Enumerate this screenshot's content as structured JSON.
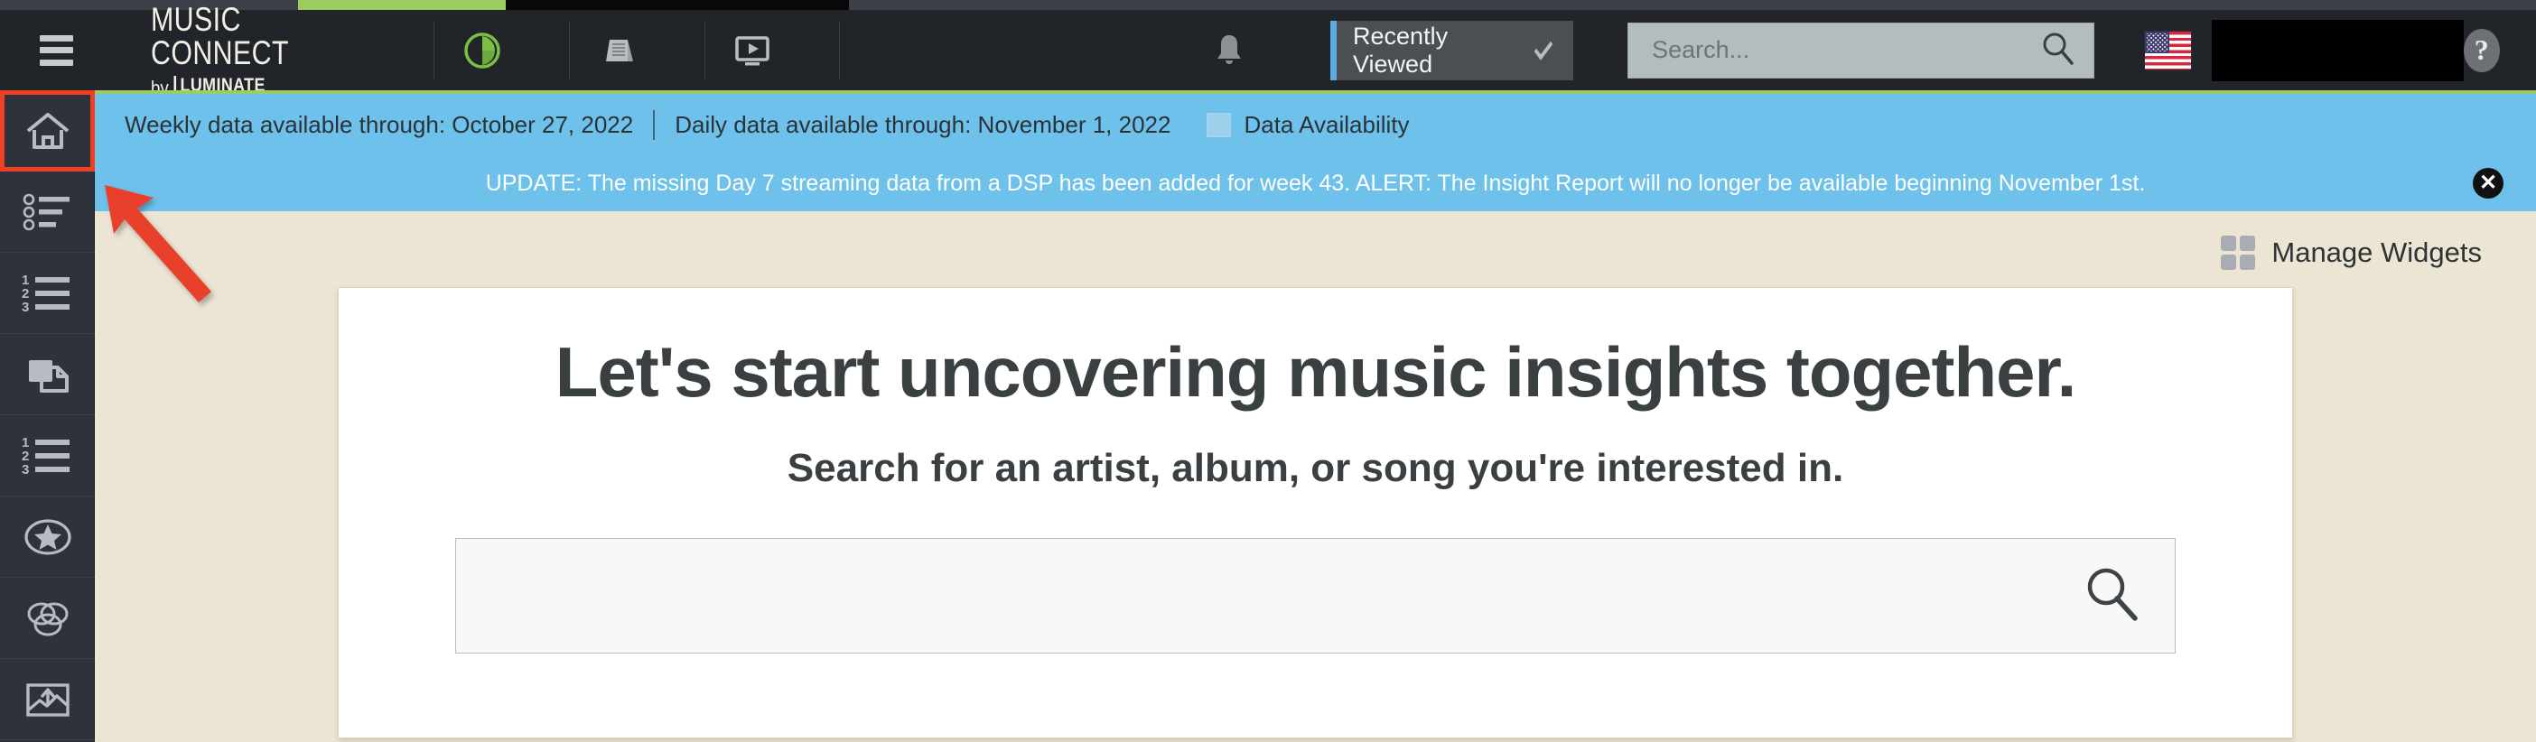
{
  "app": {
    "brand_line1": "MUSIC CONNECT",
    "brand_by": "by",
    "brand_line2": "LUMINATE",
    "accent_green": "#9ccc5d",
    "accent_blue": "#6ec1ea",
    "annotation_red": "#ef4023",
    "header_bg": "#212429",
    "sidebar_bg": "#2d323b",
    "content_bg": "#ece5d3"
  },
  "header": {
    "menu_icon": "hamburger-icon",
    "icons": [
      {
        "name": "pie-chart-icon",
        "label": "Charts"
      },
      {
        "name": "report-icon",
        "label": "Reports"
      },
      {
        "name": "video-monitor-icon",
        "label": "Media"
      }
    ],
    "notification_icon": "bell-icon",
    "dropdown": {
      "value": "Recently Viewed",
      "chevron": "chevron-down-icon"
    },
    "search": {
      "value": "",
      "placeholder": "Search...",
      "icon": "search-icon"
    },
    "locale_flag": "us-flag-icon",
    "user_box": "",
    "help_icon": "?"
  },
  "sidebar": {
    "items": [
      {
        "name": "sidebar-item-home",
        "icon": "home-icon",
        "active": true
      },
      {
        "name": "sidebar-item-bulleted-list",
        "icon": "bulleted-list-icon",
        "active": false
      },
      {
        "name": "sidebar-item-numbered-list",
        "icon": "numbered-list-icon",
        "active": false
      },
      {
        "name": "sidebar-item-documents",
        "icon": "copy-documents-icon",
        "active": false
      },
      {
        "name": "sidebar-item-ranked-list",
        "icon": "numbered-list-icon",
        "active": false
      },
      {
        "name": "sidebar-item-favorites",
        "icon": "star-circle-icon",
        "active": false
      },
      {
        "name": "sidebar-item-overlap",
        "icon": "venn-diagram-icon",
        "active": false
      },
      {
        "name": "sidebar-item-upload",
        "icon": "image-upload-icon",
        "active": false
      }
    ]
  },
  "data_bar": {
    "weekly": "Weekly data available through: October 27, 2022",
    "daily": "Daily data available through: November 1, 2022",
    "availability_link": "Data Availability",
    "availability_icon": "grid-icon"
  },
  "alert_bar": {
    "message": "UPDATE: The missing Day 7 streaming data from a DSP has been added for week 43. ALERT: The Insight Report will no longer be available beginning November 1st.",
    "close_icon": "close-icon"
  },
  "main": {
    "manage_widgets": {
      "label": "Manage Widgets",
      "icon": "widgets-grid-icon"
    },
    "card": {
      "heading": "Let's start uncovering music insights together.",
      "subheading": "Search for an artist, album, or song you're interested in.",
      "search": {
        "value": "",
        "placeholder": "",
        "icon": "search-icon"
      }
    }
  },
  "annotation": {
    "arrow": "red-arrow-pointing-to-home",
    "color": "#ef4023"
  }
}
